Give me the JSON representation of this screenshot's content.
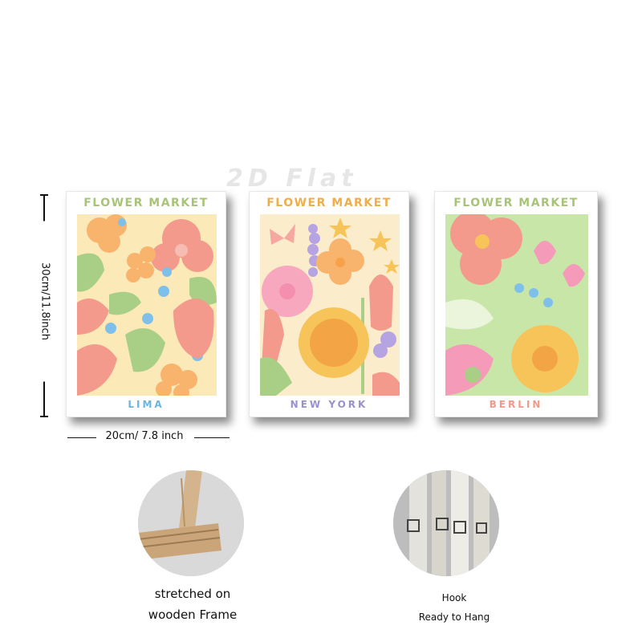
{
  "watermark": "2D Flat",
  "posters": [
    {
      "title": "FLOWER MARKET",
      "city": "LIMA",
      "title_color": "#a8c477",
      "city_color": "#6cb4e0"
    },
    {
      "title": "FLOWER MARKET",
      "city": "NEW YORK",
      "title_color": "#efae4a",
      "city_color": "#9b8fd0"
    },
    {
      "title": "FLOWER MARKET",
      "city": "BERLIN",
      "title_color": "#a8c477",
      "city_color": "#f09a8a"
    }
  ],
  "dimensions": {
    "height_label": "30cm/11.8inch",
    "width_label": "20cm/ 7.8 inch"
  },
  "features": [
    {
      "icon": "wooden-frame-corner",
      "line1": "stretched on",
      "line2": "wooden Frame"
    },
    {
      "icon": "hook",
      "line1": "Hook",
      "line2": "Ready to Hang"
    }
  ]
}
